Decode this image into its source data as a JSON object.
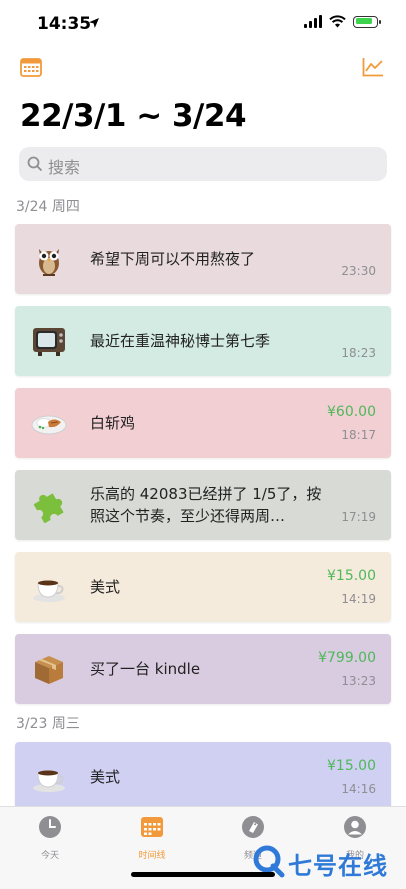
{
  "status_bar": {
    "time": "14:35"
  },
  "header": {
    "title": "22/3/1 ~ 3/24"
  },
  "search": {
    "placeholder": "搜索"
  },
  "sections": [
    {
      "label": "3/24 周四",
      "items": [
        {
          "icon": "owl",
          "text": "希望下周可以不用熬夜了",
          "amount": "",
          "time": "23:30",
          "color": "#e8dadd"
        },
        {
          "icon": "television",
          "text": "最近在重温神秘博士第七季",
          "amount": "",
          "time": "18:23",
          "color": "#d3ebe2"
        },
        {
          "icon": "chicken-rice",
          "text": "白斩鸡",
          "amount": "¥60.00",
          "time": "18:17",
          "color": "#f2cfd3"
        },
        {
          "icon": "puzzle-piece",
          "text": "乐高的 42083已经拼了 1/5了，按照这个节奏，至少还得两周…",
          "amount": "",
          "time": "17:19",
          "color": "#d8dad5"
        },
        {
          "icon": "coffee",
          "text": "美式",
          "amount": "¥15.00",
          "time": "14:19",
          "color": "#f5ebdc"
        },
        {
          "icon": "package",
          "text": "买了一台 kindle",
          "amount": "¥799.00",
          "time": "13:23",
          "color": "#d9cbe0"
        }
      ]
    },
    {
      "label": "3/23 周三",
      "items": [
        {
          "icon": "coffee",
          "text": "美式",
          "amount": "¥15.00",
          "time": "14:16",
          "color": "#cfd0f2"
        }
      ]
    }
  ],
  "tabbar": [
    {
      "label": "今天",
      "icon": "clock",
      "active": false
    },
    {
      "label": "时间线",
      "icon": "calendar",
      "active": true
    },
    {
      "label": "频道",
      "icon": "tag",
      "active": false
    },
    {
      "label": "我的",
      "icon": "person",
      "active": false
    }
  ],
  "watermark": {
    "text": "七号在线"
  },
  "colors": {
    "accent": "#f29a3b",
    "amount": "#4fb85a"
  }
}
